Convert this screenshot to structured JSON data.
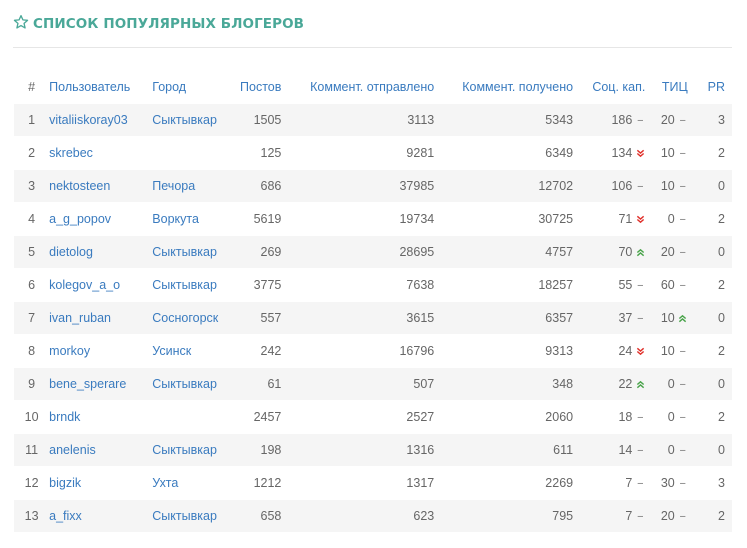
{
  "header": {
    "title": "СПИСОК ПОПУЛЯРНЫХ БЛОГЕРОВ",
    "accent_color": "#4aa898",
    "icon": "star-outline-icon"
  },
  "table": {
    "columns": {
      "num": "#",
      "user": "Пользователь",
      "city": "Город",
      "posts": "Постов",
      "sent": "Коммент. отправлено",
      "received": "Коммент. получено",
      "social": "Соц. кап.",
      "tic": "ТИЦ",
      "pr": "PR"
    },
    "rows": [
      {
        "num": "1",
        "user": "vitaliiskoray03",
        "city": "Сыктывкар",
        "posts": "1505",
        "sent": "3113",
        "received": "5343",
        "social": "186",
        "social_trend": "flat",
        "tic": "20",
        "tic_trend": "flat",
        "pr": "3"
      },
      {
        "num": "2",
        "user": "skrebec",
        "city": "",
        "posts": "125",
        "sent": "9281",
        "received": "6349",
        "social": "134",
        "social_trend": "down",
        "tic": "10",
        "tic_trend": "flat",
        "pr": "2"
      },
      {
        "num": "3",
        "user": "nektosteen",
        "city": "Печора",
        "posts": "686",
        "sent": "37985",
        "received": "12702",
        "social": "106",
        "social_trend": "flat",
        "tic": "10",
        "tic_trend": "flat",
        "pr": "0"
      },
      {
        "num": "4",
        "user": "a_g_popov",
        "city": "Воркута",
        "posts": "5619",
        "sent": "19734",
        "received": "30725",
        "social": "71",
        "social_trend": "down",
        "tic": "0",
        "tic_trend": "flat",
        "pr": "2"
      },
      {
        "num": "5",
        "user": "dietolog",
        "city": "Сыктывкар",
        "posts": "269",
        "sent": "28695",
        "received": "4757",
        "social": "70",
        "social_trend": "up",
        "tic": "20",
        "tic_trend": "flat",
        "pr": "0"
      },
      {
        "num": "6",
        "user": "kolegov_a_o",
        "city": "Сыктывкар",
        "posts": "3775",
        "sent": "7638",
        "received": "18257",
        "social": "55",
        "social_trend": "flat",
        "tic": "60",
        "tic_trend": "flat",
        "pr": "2"
      },
      {
        "num": "7",
        "user": "ivan_ruban",
        "city": "Сосногорск",
        "posts": "557",
        "sent": "3615",
        "received": "6357",
        "social": "37",
        "social_trend": "flat",
        "tic": "10",
        "tic_trend": "up",
        "pr": "0"
      },
      {
        "num": "8",
        "user": "morkoy",
        "city": "Усинск",
        "posts": "242",
        "sent": "16796",
        "received": "9313",
        "social": "24",
        "social_trend": "down",
        "tic": "10",
        "tic_trend": "flat",
        "pr": "2"
      },
      {
        "num": "9",
        "user": "bene_sperare",
        "city": "Сыктывкар",
        "posts": "61",
        "sent": "507",
        "received": "348",
        "social": "22",
        "social_trend": "up",
        "tic": "0",
        "tic_trend": "flat",
        "pr": "0"
      },
      {
        "num": "10",
        "user": "brndk",
        "city": "",
        "posts": "2457",
        "sent": "2527",
        "received": "2060",
        "social": "18",
        "social_trend": "flat",
        "tic": "0",
        "tic_trend": "flat",
        "pr": "2"
      },
      {
        "num": "11",
        "user": "anelenis",
        "city": "Сыктывкар",
        "posts": "198",
        "sent": "1316",
        "received": "611",
        "social": "14",
        "social_trend": "flat",
        "tic": "0",
        "tic_trend": "flat",
        "pr": "0"
      },
      {
        "num": "12",
        "user": "bigzik",
        "city": "Ухта",
        "posts": "1212",
        "sent": "1317",
        "received": "2269",
        "social": "7",
        "social_trend": "flat",
        "tic": "30",
        "tic_trend": "flat",
        "pr": "3"
      },
      {
        "num": "13",
        "user": "a_fixx",
        "city": "Сыктывкар",
        "posts": "658",
        "sent": "623",
        "received": "795",
        "social": "7",
        "social_trend": "flat",
        "tic": "20",
        "tic_trend": "flat",
        "pr": "2"
      }
    ]
  },
  "colors": {
    "link": "#3a7bbf",
    "trend_up": "#49a34a",
    "trend_down": "#e0302a",
    "row_stripe": "#f5f5f5"
  }
}
